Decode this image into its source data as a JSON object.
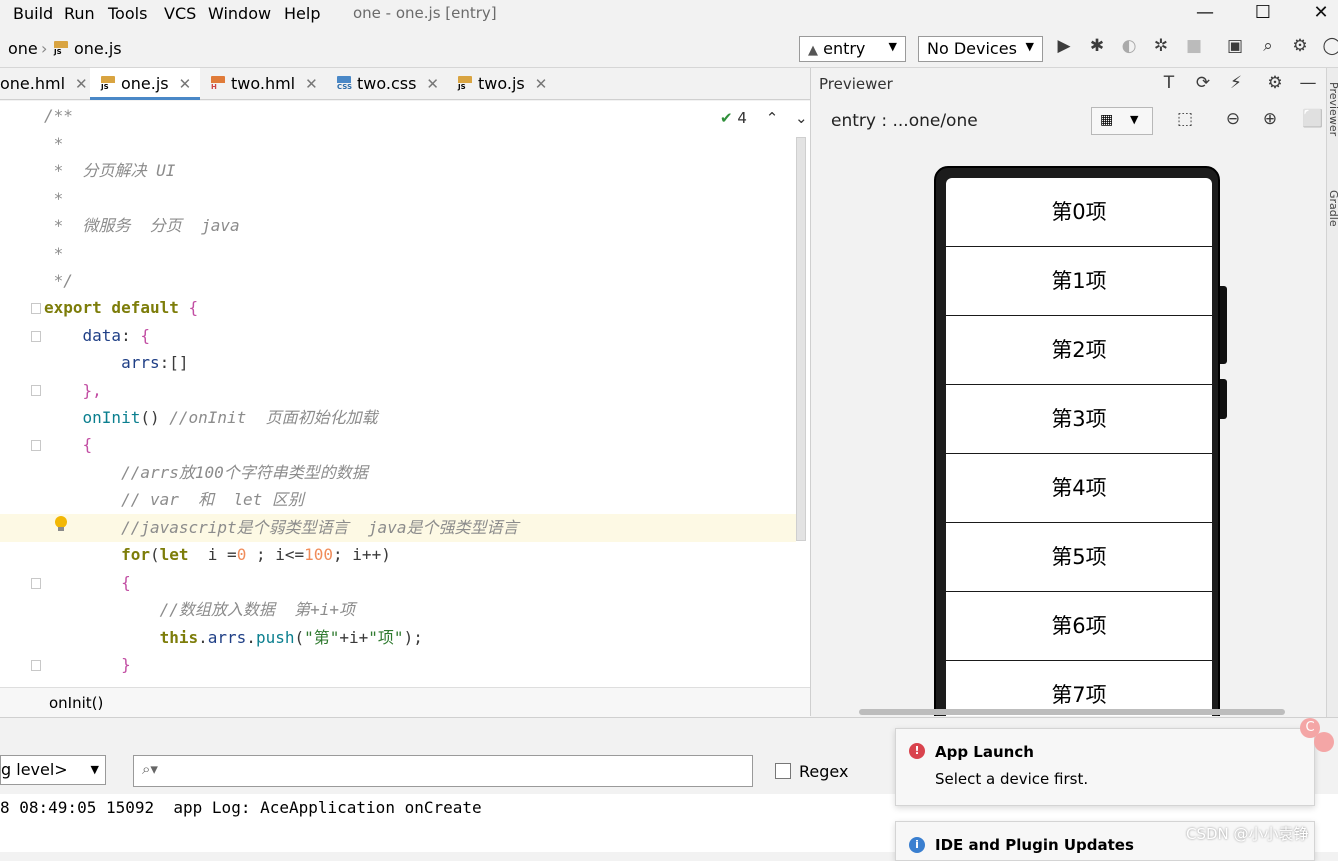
{
  "menu": {
    "items": [
      "Build",
      "Run",
      "Tools",
      "VCS",
      "Window",
      "Help"
    ],
    "window_title": "one - one.js [entry]"
  },
  "window_controls": {
    "minimize": "—",
    "maximize": "☐",
    "close": "✕"
  },
  "navbar": {
    "breadcrumb": [
      "one",
      "one.js"
    ],
    "run_config": "entry",
    "device": "No Devices"
  },
  "tabs": [
    {
      "label": "one.hml",
      "type": "H"
    },
    {
      "label": "one.js",
      "type": "JS",
      "active": true
    },
    {
      "label": "two.hml",
      "type": "H"
    },
    {
      "label": "two.css",
      "type": "CSS"
    },
    {
      "label": "two.js",
      "type": "JS"
    }
  ],
  "editor": {
    "inspection_count": "4",
    "breadcrumb_function": "onInit()"
  },
  "previewer": {
    "title": "Previewer",
    "path": "entry : ...one/one",
    "items": [
      "第0项",
      "第1项",
      "第2项",
      "第3项",
      "第4项",
      "第5项",
      "第6项",
      "第7项"
    ]
  },
  "side_tools": [
    "Previewer",
    "Gradle"
  ],
  "log": {
    "level": "g level>",
    "search_placeholder": "",
    "regex_label": "Regex",
    "line": "8 08:49:05 15092  app Log: AceApplication onCreate"
  },
  "notifications": [
    {
      "title": "App Launch",
      "body": "Select a device first.",
      "kind": "error"
    },
    {
      "title": "IDE and Plugin Updates",
      "body": "",
      "kind": "info"
    }
  ],
  "watermark": "CSDN @小小袁铮",
  "colors": {
    "accent_tab": "#4a88c7",
    "error": "#d9434d",
    "info": "#3a7fd0",
    "highlight_line": "#fdf9e4"
  }
}
